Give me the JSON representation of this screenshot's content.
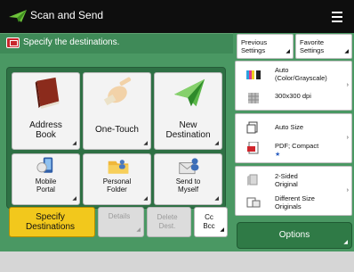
{
  "title": "Scan and Send",
  "instruction": "Specify the destinations.",
  "tiles": {
    "address_book": {
      "line1": "Address",
      "line2": "Book"
    },
    "one_touch": {
      "line1": "One-Touch"
    },
    "new_destination": {
      "line1": "New",
      "line2": "Destination"
    },
    "mobile_portal": {
      "line1": "Mobile",
      "line2": "Portal"
    },
    "personal_folder": {
      "line1": "Personal",
      "line2": "Folder"
    },
    "send_to_myself": {
      "line1": "Send to",
      "line2": "Myself"
    }
  },
  "options_row": {
    "specify_line1": "Specify",
    "specify_line2": "Destinations",
    "details": "Details",
    "delete_line1": "Delete",
    "delete_line2": "Dest.",
    "cc_line1": "Cc",
    "cc_line2": "Bcc"
  },
  "right_panel": {
    "previous_line1": "Previous",
    "previous_line2": "Settings",
    "favorite_line1": "Favorite",
    "favorite_line2": "Settings",
    "color_line1": "Auto",
    "color_line2": "(Color/Grayscale)",
    "resolution": "300x300 dpi",
    "size": "Auto Size",
    "format": "PDF; Compact",
    "sided_line1": "2-Sided",
    "sided_line2": "Original",
    "mixed_line1": "Different Size",
    "mixed_line2": "Originals",
    "options": "Options"
  },
  "colors": {
    "accent_green": "#4a9863",
    "dark_green": "#2e7044",
    "selected_yellow": "#f2c81c",
    "title_bar": "#0e0e0e"
  },
  "icons": [
    "paper-plane-icon",
    "menu-icon",
    "warning-icon",
    "address-book-icon",
    "one-touch-hand-icon",
    "new-destination-plane-icon",
    "mobile-portal-icon",
    "personal-folder-icon",
    "send-to-myself-icon",
    "color-mode-icon",
    "resolution-icon",
    "scan-size-icon",
    "file-format-icon",
    "two-sided-icon",
    "different-size-icon"
  ]
}
